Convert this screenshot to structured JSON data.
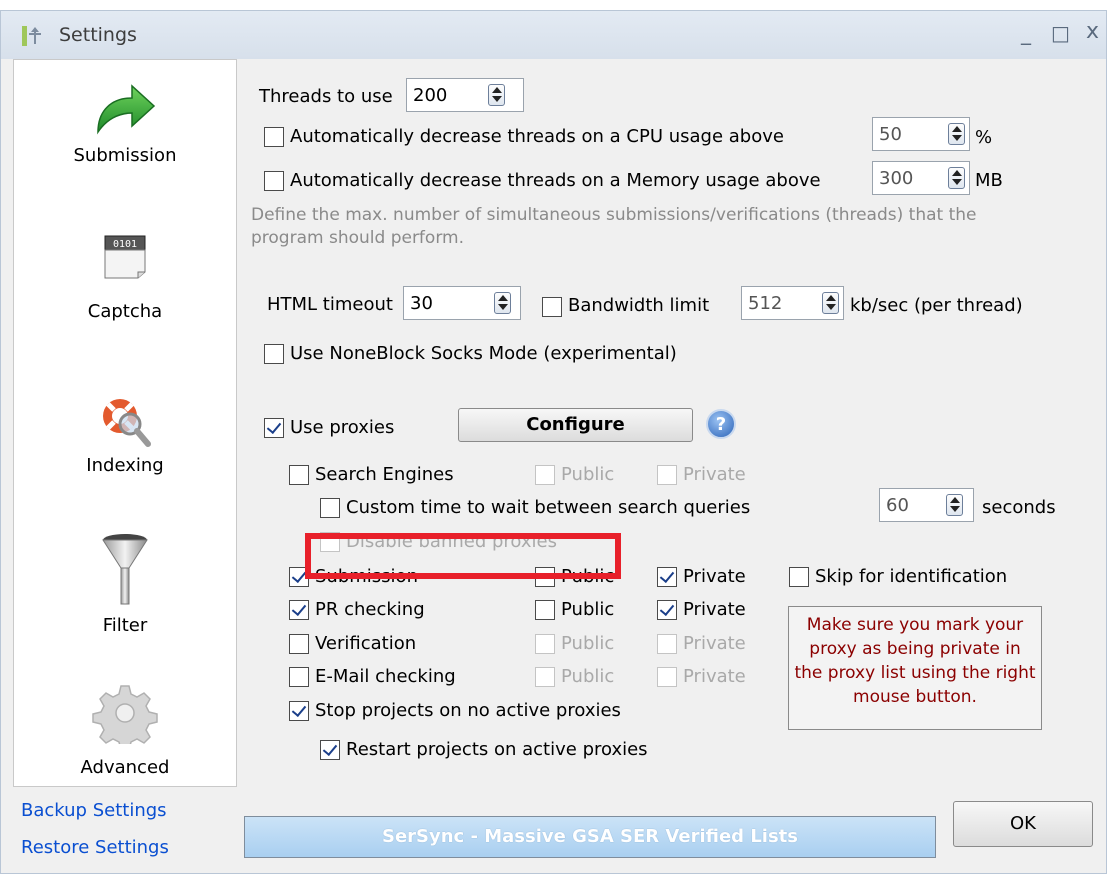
{
  "window": {
    "title": "Settings",
    "minimize": "_",
    "maximize": "□",
    "close": "x"
  },
  "sidebar": {
    "items": [
      {
        "label": "Submission",
        "icon": "green-arrow-icon"
      },
      {
        "label": "Captcha",
        "icon": "captcha-icon"
      },
      {
        "label": "Indexing",
        "icon": "lifebuoy-magnifier-icon"
      },
      {
        "label": "Filter",
        "icon": "funnel-icon"
      },
      {
        "label": "Advanced",
        "icon": "gear-icon"
      }
    ],
    "backup_link": "Backup Settings",
    "restore_link": "Restore Settings"
  },
  "threads": {
    "label": "Threads to use",
    "value": "200",
    "cpu_label": "Automatically decrease threads on a CPU usage above",
    "cpu_value": "50",
    "cpu_unit": "%",
    "cpu_checked": false,
    "mem_label": "Automatically decrease threads on a Memory usage above",
    "mem_value": "300",
    "mem_unit": "MB",
    "mem_checked": false,
    "description": "Define the max. number of simultaneous submissions/verifications (threads) that the program should perform."
  },
  "html": {
    "timeout_label": "HTML timeout",
    "timeout_value": "30",
    "bandwidth_label": "Bandwidth limit",
    "bandwidth_value": "512",
    "bandwidth_unit": "kb/sec (per thread)",
    "noneblock_label": "Use NoneBlock Socks Mode (experimental)"
  },
  "proxies": {
    "use_label": "Use proxies",
    "configure_label": "Configure",
    "help_label": "?",
    "search_engines_label": "Search Engines",
    "custom_wait_label": "Custom time to wait between search queries",
    "custom_wait_value": "60",
    "custom_wait_unit": "seconds",
    "disable_banned_label": "Disable banned proxies",
    "submission_label": "Submission",
    "pr_label": "PR checking",
    "verification_label": "Verification",
    "email_label": "E-Mail checking",
    "public_label": "Public",
    "private_label": "Private",
    "skip_label": "Skip for identification",
    "stop_label": "Stop projects on no active proxies",
    "restart_label": "Restart projects on active proxies",
    "note": "Make sure you mark your proxy as being private in the proxy list using the right mouse button."
  },
  "footer": {
    "banner": "SerSync - Massive GSA SER Verified Lists",
    "ok_label": "OK"
  }
}
